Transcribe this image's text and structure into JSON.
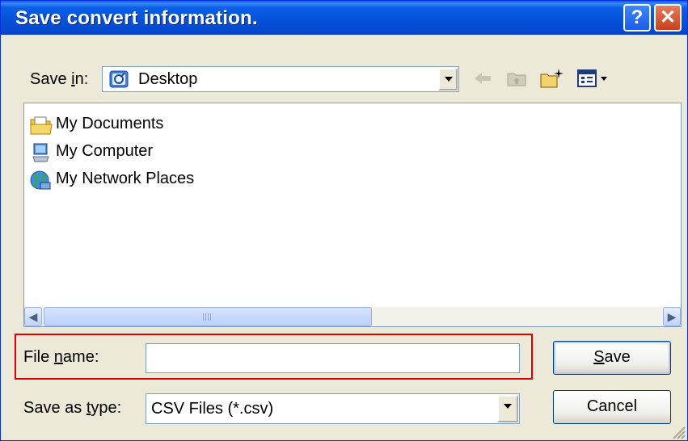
{
  "window": {
    "title": "Save convert information."
  },
  "titlebar": {
    "help_label": "?",
    "close_label": "✕",
    "help_icon": "question-icon",
    "close_icon": "close-icon"
  },
  "location_bar": {
    "label_prefix": "Save ",
    "label_accel": "i",
    "label_suffix": "n:",
    "selected_value": "Desktop",
    "toolbar_icons": [
      "back-arrow-icon",
      "up-folder-icon",
      "new-folder-icon",
      "view-menu-icon"
    ]
  },
  "file_list": {
    "items": [
      {
        "label": "My Documents",
        "icon": "my-documents-icon"
      },
      {
        "label": "My Computer",
        "icon": "my-computer-icon"
      },
      {
        "label": "My Network Places",
        "icon": "network-places-icon"
      }
    ]
  },
  "filename_field": {
    "label_prefix": "File ",
    "label_accel": "n",
    "label_suffix": "ame:",
    "value": ""
  },
  "type_field": {
    "label_prefix": "Save as ",
    "label_accel": "t",
    "label_suffix": "ype:",
    "selected_value": "CSV Files (*.csv)"
  },
  "buttons": {
    "save_accel": "S",
    "save_rest": "ave",
    "cancel_label": "Cancel"
  },
  "colors": {
    "titlebar": "#0550D8",
    "dialog_bg": "#ECE9D8",
    "highlight_box": "#E00000",
    "field_border": "#7F9DB9"
  }
}
